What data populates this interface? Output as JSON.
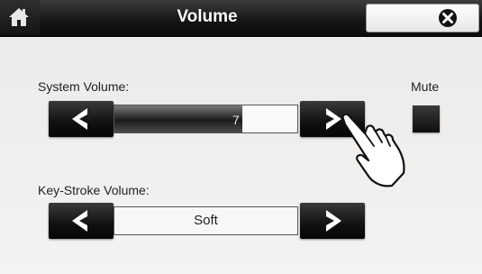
{
  "header": {
    "title": "Volume",
    "home_icon": "home-icon",
    "close_icon": "close-x-icon"
  },
  "system_volume": {
    "label": "System Volume:",
    "value": "7",
    "level_fraction": 0.7
  },
  "mute": {
    "label": "Mute",
    "checked": false
  },
  "keystroke_volume": {
    "label": "Key-Stroke Volume:",
    "value": "Soft"
  },
  "colors": {
    "titlebar": "#161616",
    "button": "#111111",
    "background": "#f1f0ee"
  }
}
